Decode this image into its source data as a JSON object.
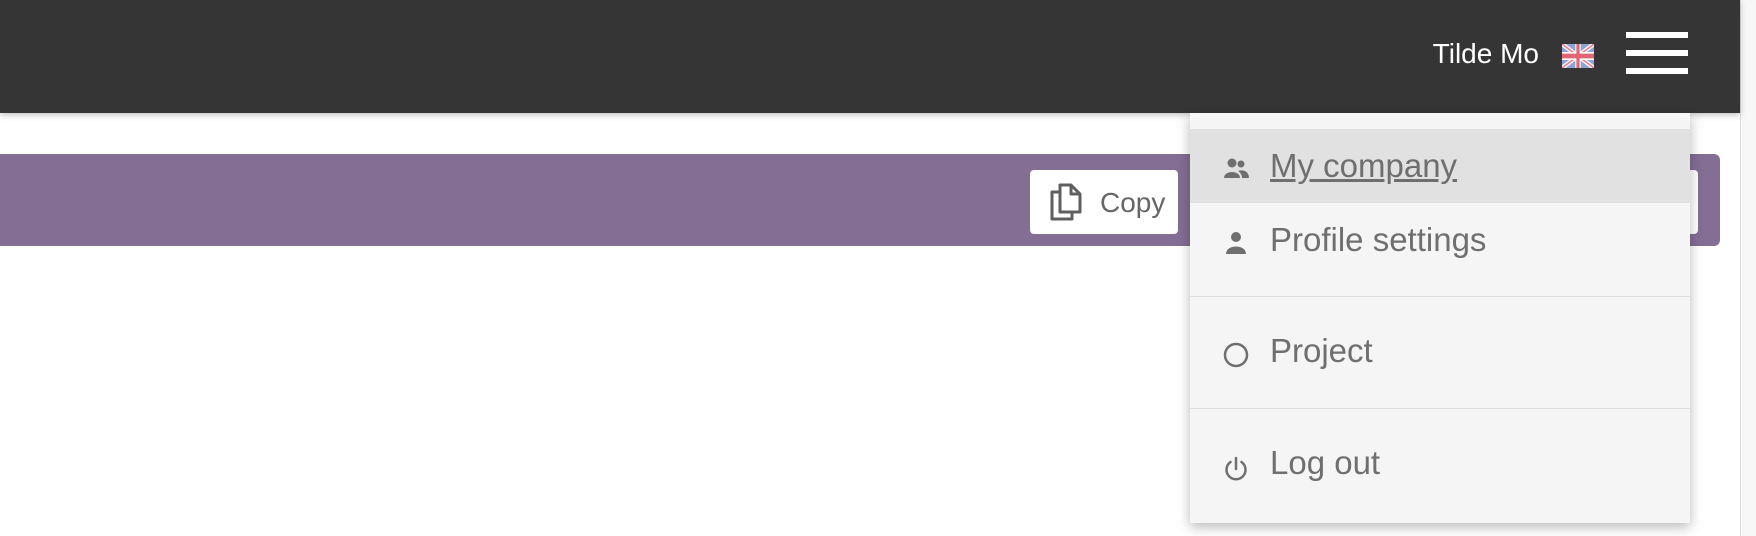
{
  "header": {
    "username": "Tilde Mo",
    "language_flag_icon": "uk-flag-icon",
    "menu_icon": "hamburger-menu-icon",
    "background_color": "#353535"
  },
  "action_bar": {
    "background_color": "#846e94",
    "copy_button": {
      "label": "Copy",
      "icon": "copy-icon"
    }
  },
  "user_menu": {
    "items": [
      {
        "label": "My company",
        "icon": "people-icon",
        "active": true
      },
      {
        "label": "Profile settings",
        "icon": "person-icon",
        "active": false
      },
      {
        "label": "Project",
        "icon": "circle-icon",
        "active": false
      },
      {
        "label": "Log out",
        "icon": "power-icon",
        "active": false
      }
    ]
  }
}
